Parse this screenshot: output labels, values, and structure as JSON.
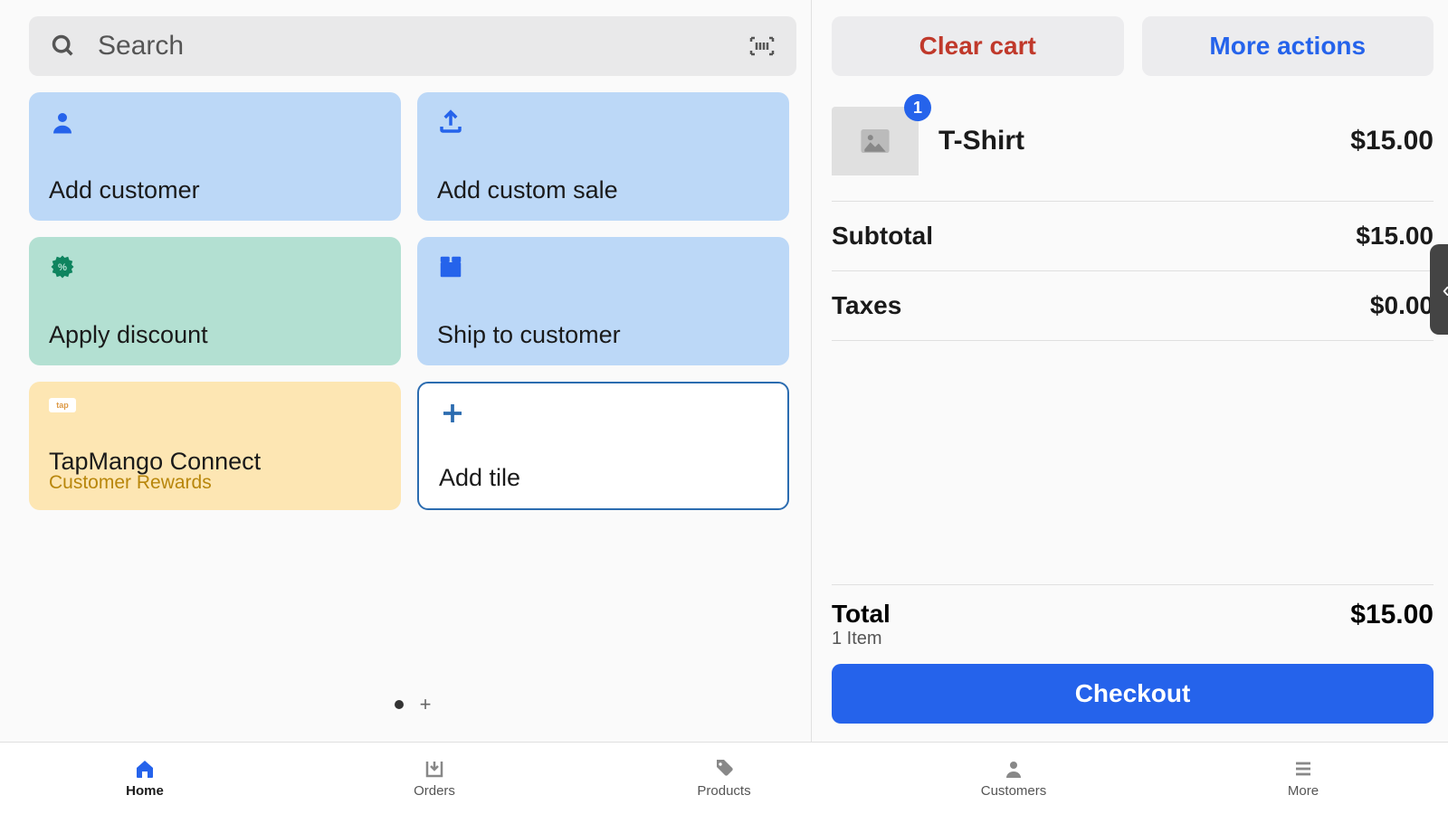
{
  "search": {
    "placeholder": "Search"
  },
  "tiles": {
    "add_customer": "Add customer",
    "add_custom_sale": "Add custom sale",
    "apply_discount": "Apply discount",
    "ship_to_customer": "Ship to customer",
    "tapmango_title": "TapMango Connect",
    "tapmango_sub": "Customer Rewards",
    "tapmango_badge": "tap",
    "add_tile": "Add tile"
  },
  "cart": {
    "clear_label": "Clear cart",
    "more_label": "More actions",
    "item": {
      "name": "T-Shirt",
      "price": "$15.00",
      "qty": "1"
    },
    "subtotal_label": "Subtotal",
    "subtotal_value": "$15.00",
    "taxes_label": "Taxes",
    "taxes_value": "$0.00",
    "total_label": "Total",
    "item_count": "1 Item",
    "total_value": "$15.00",
    "checkout_label": "Checkout"
  },
  "nav": {
    "home": "Home",
    "orders": "Orders",
    "products": "Products",
    "customers": "Customers",
    "more": "More"
  }
}
